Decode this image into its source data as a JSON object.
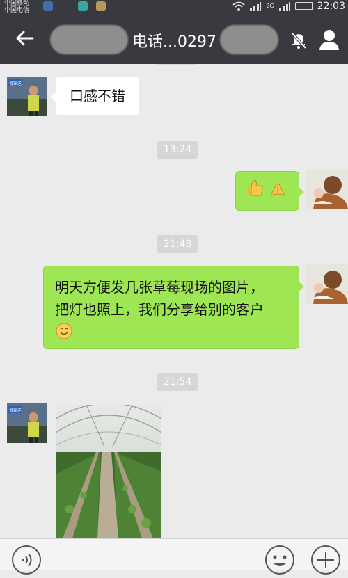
{
  "status_bar": {
    "carrier_line1": "中国移动",
    "carrier_line2": "中国电信",
    "network_2g": "2G",
    "time": "22:03"
  },
  "header": {
    "title": "电话...0297",
    "back_icon": "arrow-left-icon",
    "mute_icon": "bell-off-icon",
    "profile_icon": "person-icon"
  },
  "messages": [
    {
      "side": "left",
      "text": "口感不错"
    },
    {
      "time": "13:24"
    },
    {
      "side": "right",
      "content": "thumbs-up-and-clasped-hands-emoji"
    },
    {
      "time": "21:48"
    },
    {
      "side": "right",
      "line1": "明天方便发几张草莓现场的图片，",
      "line2": "把灯也照上，我们分享给别的客户",
      "emoji": "smile-emoji"
    },
    {
      "time": "21:54"
    },
    {
      "side": "left",
      "content": "greenhouse-strawberry-photo"
    }
  ],
  "avatar_left_label": "每家送",
  "input_bar": {
    "voice_icon": "voice-icon",
    "emoji_icon": "smile-face-icon",
    "plus_icon": "plus-icon"
  },
  "colors": {
    "header_bg": "#393a3f",
    "chat_bg": "#ebebeb",
    "sent_bubble": "#9ee654",
    "received_bubble": "#ffffff",
    "timestamp_bg": "#d6d6d6"
  }
}
